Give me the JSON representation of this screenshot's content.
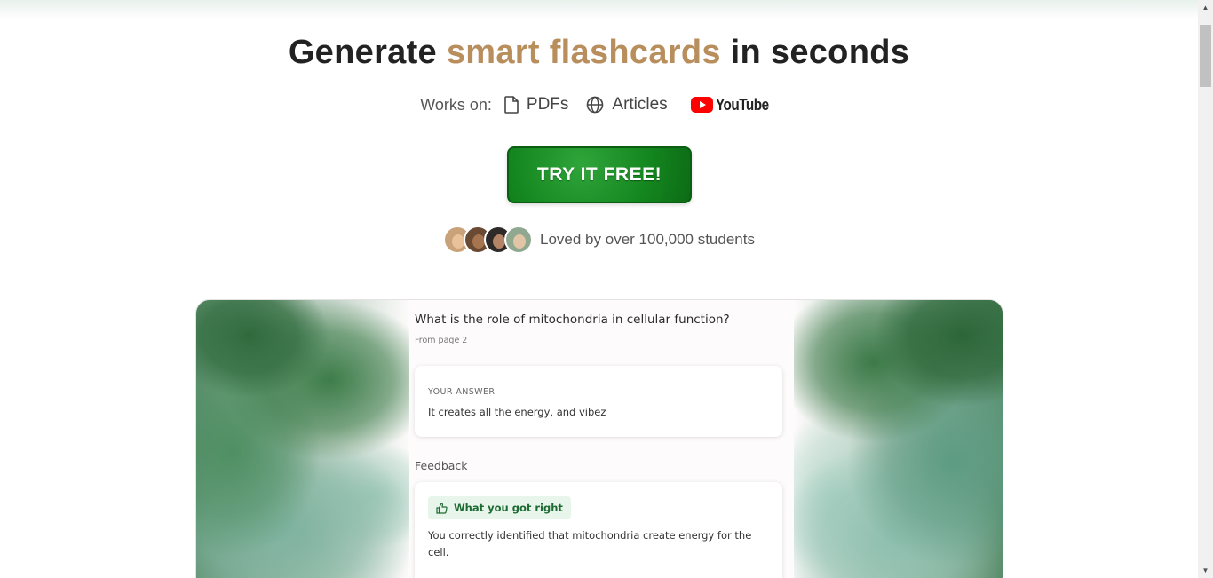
{
  "headline": {
    "prefix": "Generate",
    "accent": "smart flashcards",
    "suffix": "in seconds",
    "accent_color": "#b98e5d"
  },
  "works_on": {
    "label": "Works on:",
    "sources": [
      {
        "icon": "document-icon",
        "label": "PDFs"
      },
      {
        "icon": "globe-icon",
        "label": "Articles"
      }
    ],
    "youtube_label": "YouTube"
  },
  "cta": {
    "label": "TRY IT FREE!",
    "color": "#14861f"
  },
  "social_proof": {
    "text": "Loved by over 100,000 students",
    "avatars": [
      "student-avatar-1",
      "student-avatar-2",
      "student-avatar-3",
      "student-avatar-4"
    ]
  },
  "demo": {
    "question": "What is the role of mitochondria in cellular function?",
    "source": "From page 2",
    "answer_label": "YOUR ANSWER",
    "answer_text": "It creates all the energy, and vibez",
    "feedback_title": "Feedback",
    "badge_label": "What you got right",
    "feedback_text": "You correctly identified that mitochondria create energy for the cell."
  }
}
